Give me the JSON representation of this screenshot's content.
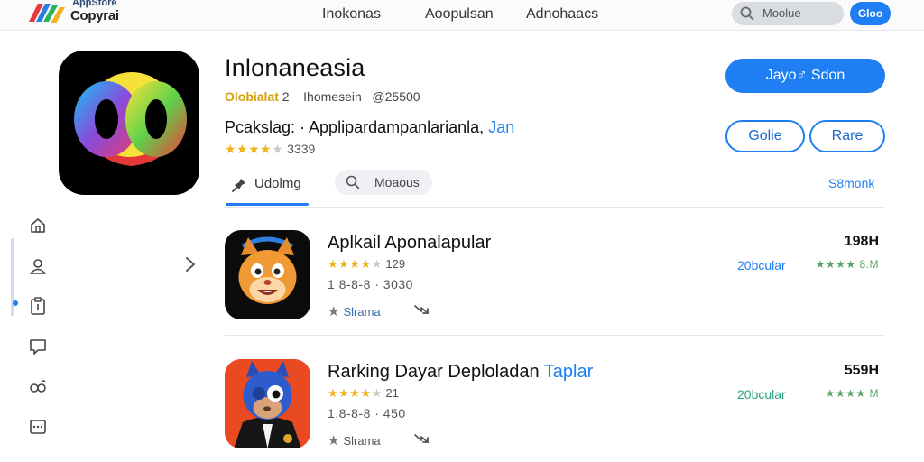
{
  "header": {
    "logo_small": "AppStore",
    "logo_big": "Copyrai",
    "tabs": [
      "Inokonas",
      "Aoopulsan",
      "Adnohaacs"
    ],
    "search_placeholder": "Moolue",
    "action_button": "Gloo"
  },
  "app": {
    "title": "Inlonaneasia",
    "developer": "Olobialat",
    "meta_count": "2",
    "meta_region": "Ihomesein",
    "meta_price": "@25500",
    "package_label": "Pcakslag: · Applipardampanlarianla,",
    "package_link": "Jan",
    "stars_filled": "★★★★",
    "stars_empty": "★",
    "rating_count": "3339",
    "rating_value": 4,
    "primary_button": "Jayo♂ Sdon",
    "secondary_button_1": "Golie",
    "secondary_button_2": "Rare"
  },
  "tabs": {
    "active_label": "Udolmg",
    "search_label": "Moaous",
    "link_label": "S8monk"
  },
  "list": [
    {
      "title": "Aplkail Aponalapular",
      "title_accent": "",
      "stars_filled": "★★★★",
      "stars_empty": "★",
      "rating_count": "129",
      "downloads": "1 8-8-8 · 3030",
      "meta_label": "Slrama",
      "size": "198H",
      "category": "20bcular",
      "mini_stars": "★★★★ 8.M"
    },
    {
      "title": "Rarking Dayar Deploladan",
      "title_accent": "Taplar",
      "stars_filled": "★★★★",
      "stars_empty": "★",
      "rating_count": "21",
      "downloads": "1.8-8-8 · 450",
      "meta_label": "Slrama",
      "size": "559H",
      "category": "20bcular",
      "mini_stars": "★★★★ M"
    }
  ],
  "colors": {
    "accent": "#1e7ef2",
    "star": "#f0b21b",
    "developer": "#d4a20c"
  }
}
